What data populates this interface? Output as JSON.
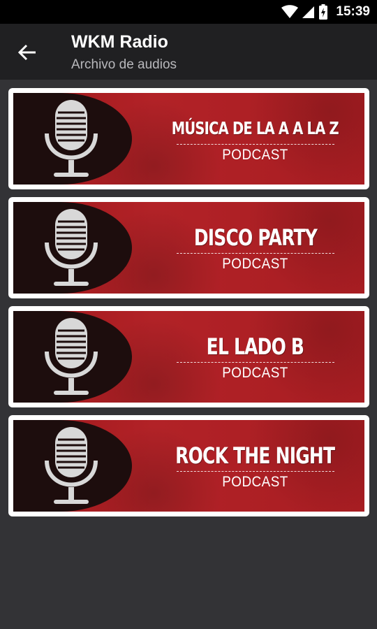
{
  "status_bar": {
    "time": "15:39"
  },
  "app_bar": {
    "title": "WKM Radio",
    "subtitle": "Archivo de audios"
  },
  "podcasts": [
    {
      "title": "MÚSICA DE LA A A LA Z",
      "label": "PODCAST"
    },
    {
      "title": "DISCO PARTY",
      "label": "PODCAST"
    },
    {
      "title": "EL LADO B",
      "label": "PODCAST"
    },
    {
      "title": "ROCK THE NIGHT",
      "label": "PODCAST"
    }
  ],
  "icons": {
    "back": "arrow-left-icon",
    "wifi": "wifi-icon",
    "signal": "signal-icon",
    "battery": "battery-icon",
    "microphone": "microphone-icon"
  },
  "colors": {
    "accent_red": "#b22227",
    "background": "#333336",
    "app_bar": "#202022"
  }
}
